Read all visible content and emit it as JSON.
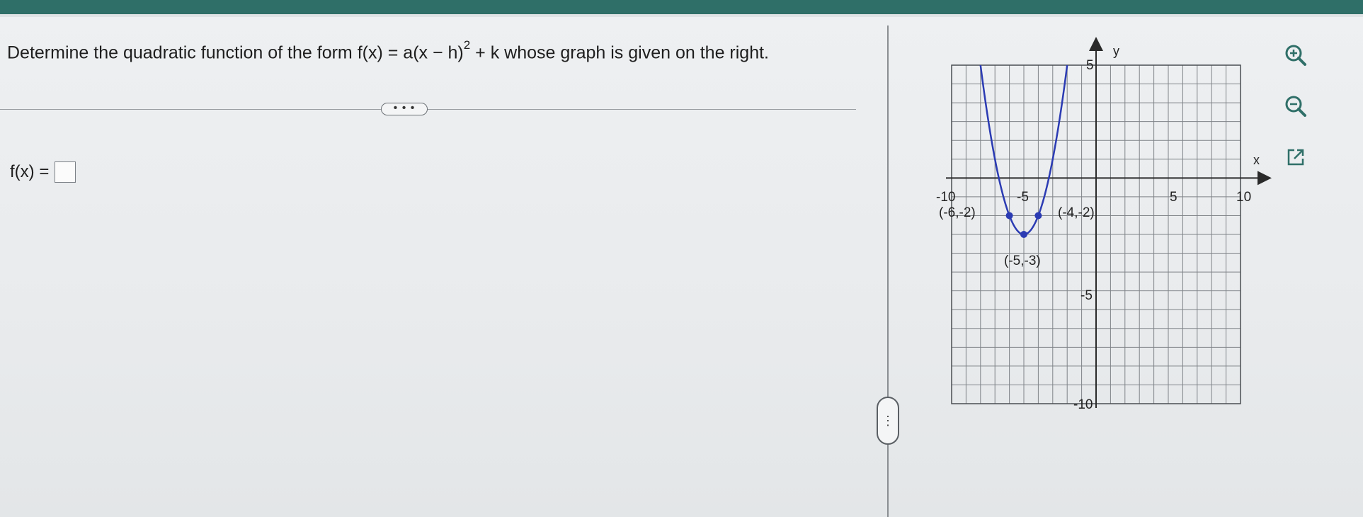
{
  "question": {
    "prefix": "Determine the quadratic function of the form f(x) = a(x − h)",
    "exponent": "2",
    "suffix": " + k whose graph is given on the right."
  },
  "more_button": "• • •",
  "answer": {
    "label": "f(x) =",
    "value": ""
  },
  "drag_handle": "⋮",
  "graph": {
    "axis_x_label": "x",
    "axis_y_label": "y",
    "tick_x_neg10": "-10",
    "tick_x_neg5": "-5",
    "tick_x_5": "5",
    "tick_x_10": "10",
    "tick_y_5": "5",
    "tick_y_neg5": "-5",
    "tick_y_neg10": "-10",
    "point_labels": [
      "(-6,-2)",
      "(-4,-2)",
      "(-5,-3)"
    ],
    "curve_color": "#2b3bb3",
    "grid_color": "#7f8388"
  },
  "chart_data": {
    "type": "line",
    "xlim": [
      -10,
      10
    ],
    "ylim": [
      -12,
      6
    ],
    "grid": true,
    "xlabel": "x",
    "ylabel": "y",
    "function": "f(x) = (x + 5)^2 - 3",
    "series": [
      {
        "x": [
          -8.0,
          -7,
          -6,
          -5,
          -4,
          -3,
          -2.0
        ],
        "values": [
          6,
          1,
          -2,
          -3,
          -2,
          1,
          6
        ]
      }
    ],
    "points": [
      {
        "x": -6,
        "y": -2,
        "label": "(-6,-2)"
      },
      {
        "x": -4,
        "y": -2,
        "label": "(-4,-2)"
      },
      {
        "x": -5,
        "y": -3,
        "label": "(-5,-3)"
      }
    ]
  },
  "tools": {
    "zoom_in": "zoom-in-icon",
    "zoom_out": "zoom-out-icon",
    "popout": "external-link-icon"
  }
}
